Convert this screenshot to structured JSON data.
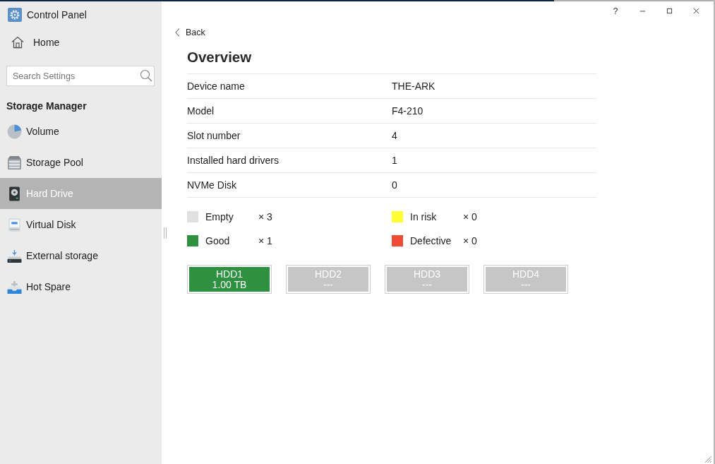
{
  "sidebar": {
    "app_title": "Control Panel",
    "home": "Home",
    "search": {
      "placeholder": "Search Settings"
    },
    "section_title": "Storage Manager",
    "items": [
      {
        "label": "Volume",
        "selected": false
      },
      {
        "label": "Storage Pool",
        "selected": false
      },
      {
        "label": "Hard Drive",
        "selected": true
      },
      {
        "label": "Virtual Disk",
        "selected": false
      },
      {
        "label": "External storage",
        "selected": false
      },
      {
        "label": "Hot Spare",
        "selected": false
      }
    ]
  },
  "title_bar": {
    "help": "?"
  },
  "back": "Back",
  "title": "Overview",
  "details": [
    {
      "label": "Device name",
      "value": "THE-ARK"
    },
    {
      "label": "Model",
      "value": "F4-210"
    },
    {
      "label": "Slot number",
      "value": "4"
    },
    {
      "label": "Installed hard drivers",
      "value": "1"
    },
    {
      "label": "NVMe Disk",
      "value": "0"
    }
  ],
  "legend": [
    {
      "label": "Empty",
      "count": "× 3",
      "color": "#e0e0e0"
    },
    {
      "label": "In risk",
      "count": "× 0",
      "color": "#ffff33"
    },
    {
      "label": "Good",
      "count": "× 1",
      "color": "#2e9140"
    },
    {
      "label": "Defective",
      "count": "× 0",
      "color": "#f04b37"
    }
  ],
  "slots": [
    {
      "name": "HDD1",
      "capacity": "1.00 TB",
      "color": "#2e9140"
    },
    {
      "name": "HDD2",
      "capacity": "---",
      "color": "#c6c6c6"
    },
    {
      "name": "HDD3",
      "capacity": "---",
      "color": "#c6c6c6"
    },
    {
      "name": "HDD4",
      "capacity": "---",
      "color": "#c6c6c6"
    }
  ]
}
